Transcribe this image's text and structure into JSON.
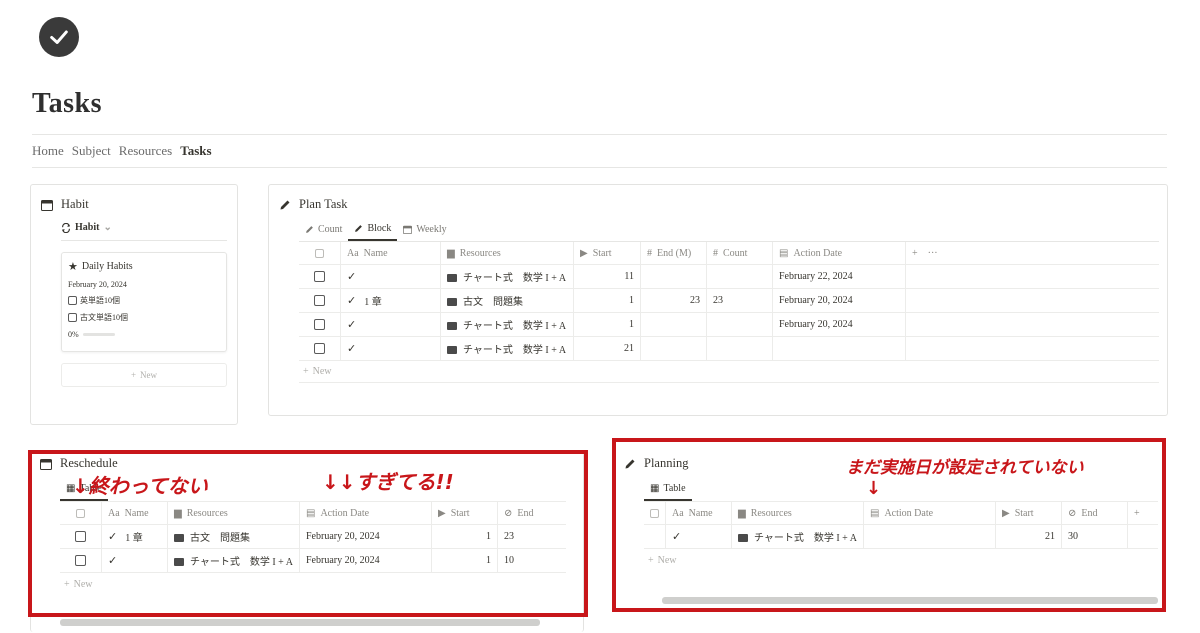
{
  "page": {
    "title": "Tasks",
    "icon": "check-circle-icon"
  },
  "nav": [
    "Home",
    "Subject",
    "Resources",
    "Tasks"
  ],
  "nav_active": "Tasks",
  "habit": {
    "title": "Habit",
    "view_label": "Habit",
    "card": {
      "title": "Daily Habits",
      "date": "February 20, 2024",
      "items": [
        "英単語10個",
        "古文単語10個"
      ],
      "progress": "0%",
      "progress_value": 0
    },
    "new_label": "New"
  },
  "plan_task": {
    "title": "Plan Task",
    "tabs": [
      "Count",
      "Block",
      "Weekly"
    ],
    "active_tab": "Block",
    "columns": [
      "Name",
      "Resources",
      "Start",
      "End (M)",
      "Count",
      "Action Date"
    ],
    "rows": [
      {
        "name": "",
        "resource": "チャート式　数学 I + A",
        "start": "11",
        "end": "",
        "count": "",
        "date": "February 22, 2024"
      },
      {
        "name": "1 章",
        "resource": "古文　問題集",
        "start": "1",
        "end": "23",
        "count": "23",
        "date": "February 20, 2024"
      },
      {
        "name": "",
        "resource": "チャート式　数学 I + A",
        "start": "1",
        "end": "",
        "count": "",
        "date": "February 20, 2024"
      },
      {
        "name": "",
        "resource": "チャート式　数学 I + A",
        "start": "21",
        "end": "",
        "count": "",
        "date": ""
      }
    ],
    "add_label": "+",
    "more_label": "···",
    "new_label": "New"
  },
  "reschedule": {
    "title": "Reschedule",
    "tab": "Table",
    "columns": [
      "Name",
      "Resources",
      "Action Date",
      "Start",
      "End"
    ],
    "rows": [
      {
        "name": "1 章",
        "resource": "古文　問題集",
        "date": "February 20, 2024",
        "start": "1",
        "end": "23"
      },
      {
        "name": "",
        "resource": "チャート式　数学 I + A",
        "date": "February 20, 2024",
        "start": "1",
        "end": "10"
      }
    ],
    "new_label": "New",
    "annotation_left": "↓終わってない",
    "annotation_right": "↓↓すぎてる!!"
  },
  "planning": {
    "title": "Planning",
    "tab": "Table",
    "columns": [
      "Name",
      "Resources",
      "Action Date",
      "Start",
      "End"
    ],
    "rows": [
      {
        "name": "",
        "resource": "チャート式　数学 I + A",
        "date": "",
        "start": "21",
        "end": "30"
      }
    ],
    "add_label": "+",
    "new_label": "New",
    "annotation": "まだ実施日が設定されていない",
    "annotation_arrow": "↓"
  },
  "colors": {
    "annotation_red": "#c8161a",
    "text": "#37352f",
    "muted": "#8a8883"
  }
}
